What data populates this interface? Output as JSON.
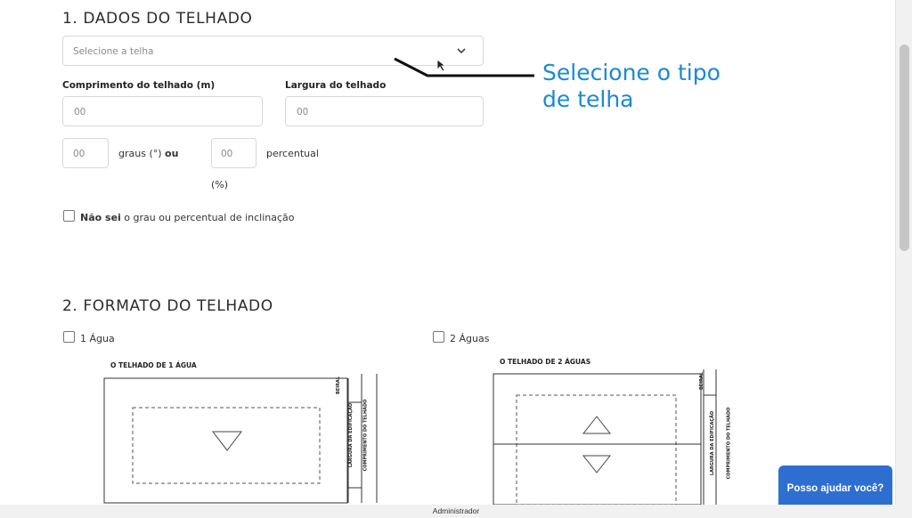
{
  "section1": {
    "title": "1. DADOS DO TELHADO",
    "select_placeholder": "Selecione a telha",
    "length_label": "Comprimento do telhado (m)",
    "length_placeholder": "00",
    "width_label": "Largura do telhado",
    "width_placeholder": "00",
    "degrees_placeholder": "00",
    "degrees_label_text": "graus (°)",
    "degrees_label_bold": "ou",
    "percent_placeholder": "00",
    "percent_label": "percentual",
    "percent_sign": "(%)",
    "unknown_bold": "Não sei",
    "unknown_text": "o grau ou percentual de inclinação"
  },
  "annotation": {
    "line1": "Selecione o tipo",
    "line2": "de telha",
    "color": "#1a8ad3"
  },
  "section2": {
    "title": "2. FORMATO DO TELHADO",
    "option1": "1 Água",
    "option2": "2 Águas",
    "diagram1_title": "O TELHADO DE 1 ÁGUA",
    "diagram2_title": "O TELHADO DE 2 ÁGUAS",
    "beiral": "BEIRAL",
    "largura": "LARGURA DA EDIFICAÇÃO",
    "comprimento": "COMPRIMENTO DO TELHADO"
  },
  "help_button": "Posso ajudar você?",
  "footer": "Administrador"
}
